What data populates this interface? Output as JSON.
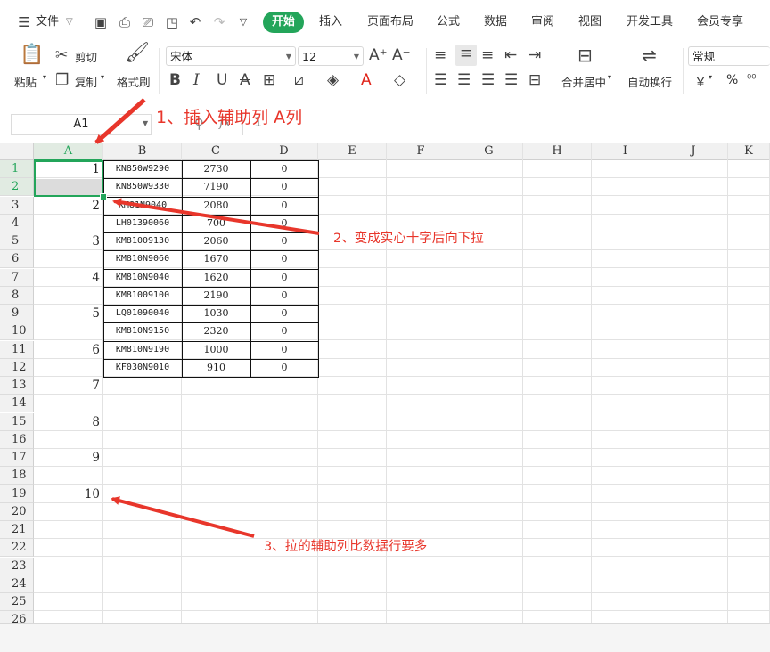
{
  "menubar": {
    "file_label": "文件",
    "tabs": [
      "开始",
      "插入",
      "页面布局",
      "公式",
      "数据",
      "审阅",
      "视图",
      "开发工具",
      "会员专享"
    ]
  },
  "ribbon": {
    "paste": "粘贴",
    "cut": "剪切",
    "copy": "复制",
    "format_painter": "格式刷",
    "font_name": "宋体",
    "font_size": "12",
    "merge_center": "合并居中",
    "wrap_text": "自动换行",
    "number_format": "常规",
    "currency": "￥",
    "percent": "%"
  },
  "formula_bar": {
    "name_box": "A1",
    "fx": "fx",
    "formula_value": "1"
  },
  "sheet": {
    "columns": [
      "A",
      "B",
      "C",
      "D",
      "E",
      "F",
      "G",
      "H",
      "I",
      "J",
      "K"
    ],
    "rows": [
      "1",
      "2",
      "3",
      "4",
      "5",
      "6",
      "7",
      "8",
      "9",
      "10",
      "11",
      "12",
      "13",
      "14",
      "15",
      "16",
      "17",
      "18",
      "19",
      "20",
      "21",
      "22",
      "23",
      "24",
      "25",
      "26"
    ],
    "col_a": [
      "1",
      "",
      "2",
      "",
      "3",
      "",
      "4",
      "",
      "5",
      "",
      "6",
      "",
      "7",
      "",
      "8",
      "",
      "9",
      "",
      "10",
      "",
      "",
      "",
      "",
      "",
      "",
      ""
    ],
    "col_b": [
      "KN850W9290",
      "KN850W9330",
      "KM81N9040",
      "LH01390060",
      "KM81009130",
      "KM810N9060",
      "KM810N9040",
      "KM81009100",
      "LQ01090040",
      "KM810N9150",
      "KM810N9190",
      "KF030N9010"
    ],
    "col_c": [
      "2730",
      "7190",
      "2080",
      "700",
      "2060",
      "1670",
      "1620",
      "2190",
      "1030",
      "2320",
      "1000",
      "910"
    ],
    "col_d": [
      "0",
      "0",
      "0",
      "0",
      "0",
      "0",
      "0",
      "0",
      "0",
      "0",
      "0",
      "0"
    ]
  },
  "annotations": {
    "step1": "1、插入辅助列 A列",
    "step2": "2、变成实心十字后向下拉",
    "step3": "3、拉的辅助列比数据行要多",
    "color": "#e8362b"
  },
  "colors": {
    "accent": "#23a55a"
  }
}
